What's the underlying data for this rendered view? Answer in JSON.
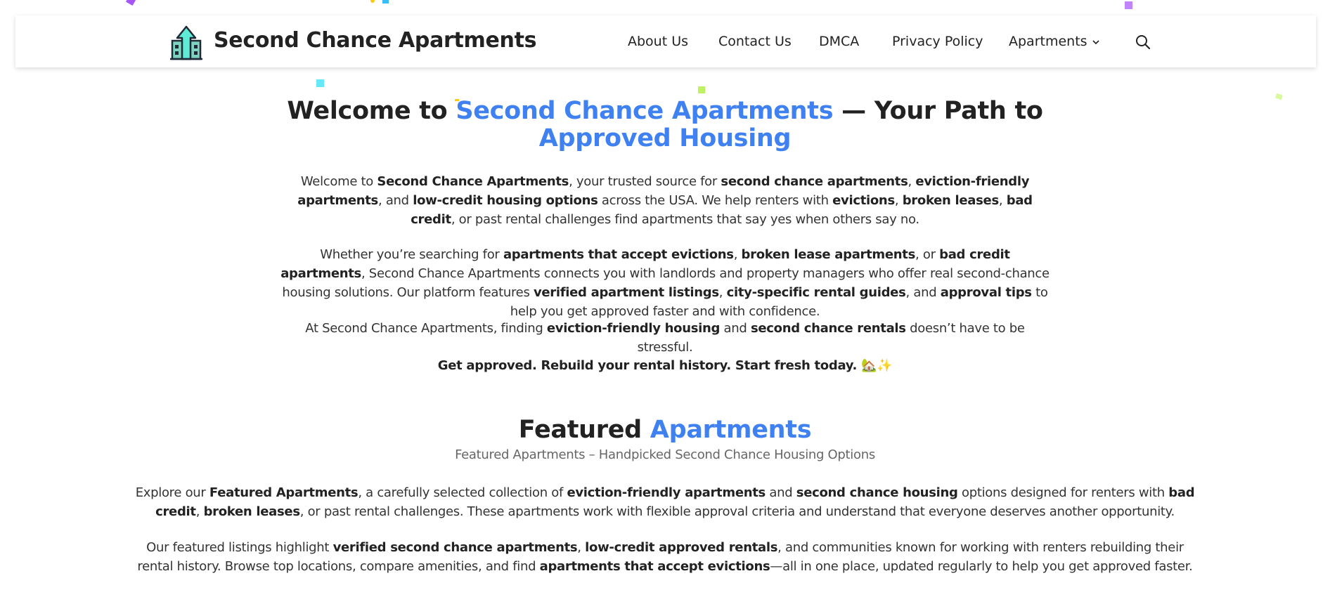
{
  "header": {
    "site_title": "Second Chance Apartments",
    "logo_icon": "apartment-arrow-up-icon",
    "nav": [
      {
        "label": "About Us"
      },
      {
        "label": "Contact Us"
      },
      {
        "label": "DMCA"
      },
      {
        "label": "Privacy Policy"
      },
      {
        "label": "Apartments",
        "icon": "chevron-down-icon"
      }
    ],
    "search_icon": "search-icon"
  },
  "colors": {
    "accent": "#3f81f0",
    "text": "#222222",
    "subtitle": "#666666",
    "confetti": [
      "#a855f7",
      "#facc15",
      "#38bdf8",
      "#c084fc",
      "#67e8f9",
      "#bef264",
      "#d9f99d"
    ]
  },
  "hero": {
    "title_1": "Welcome to ",
    "title_2": "Second Chance Apartments",
    "title_3": " — Your Path to ",
    "title_4": "Approved Housing",
    "p1": {
      "t1": "Welcome to ",
      "b1": "Second Chance Apartments",
      "t2": ", your trusted source for ",
      "b2": "second chance apartments",
      "t3": ", ",
      "b3": "eviction-friendly apartments",
      "t4": ", and ",
      "b4": "low-credit housing options",
      "t5": " across the USA. We help renters with ",
      "b5": "evictions",
      "t6": ", ",
      "b6": "broken leases",
      "t7": ", ",
      "b7": "bad credit",
      "t8": ", or past rental challenges find apartments that say yes when others say no."
    },
    "p2": {
      "t1": "Whether you’re searching for ",
      "b1": "apartments that accept evictions",
      "t2": ", ",
      "b2": "broken lease apartments",
      "t3": ", or ",
      "b3": "bad credit apartments",
      "t4": ", Second Chance Apartments connects you with landlords and property managers who offer real second-chance housing solutions. Our platform features ",
      "b4": "verified apartment listings",
      "t5": ", ",
      "b5": "city-specific rental guides",
      "t6": ", and ",
      "b6": "approval tips",
      "t7": " to help you get approved faster and with confidence."
    },
    "p3": {
      "t1": "At Second Chance Apartments, finding ",
      "b1": "eviction-friendly housing",
      "t2": " and ",
      "b2": "second chance rentals",
      "t3": " doesn’t have to be stressful."
    },
    "p4": {
      "b1": "Get approved. Rebuild your rental history. Start fresh today. ",
      "emoji": "🏡✨"
    }
  },
  "featured": {
    "title_1": "Featured ",
    "title_2": "Apartments",
    "subtitle": "Featured Apartments – Handpicked Second Chance Housing Options",
    "p1": {
      "t1": "Explore our ",
      "b1": "Featured Apartments",
      "t2": ", a carefully selected collection of ",
      "b2": "eviction-friendly apartments",
      "t3": " and ",
      "b3": "second chance housing",
      "t4": " options designed for renters with ",
      "b4": "bad credit",
      "t5": ", ",
      "b5": "broken leases",
      "t6": ", or past rental challenges. These apartments work with flexible approval criteria and understand that everyone deserves another opportunity."
    },
    "p2": {
      "t1": "Our featured listings highlight ",
      "b1": "verified second chance apartments",
      "t2": ", ",
      "b2": "low-credit approved rentals",
      "t3": ", and communities known for working with renters rebuilding their rental history. Browse top locations, compare amenities, and find ",
      "b3": "apartments that accept evictions",
      "t4": "—all in one place, updated regularly to help you get approved faster."
    }
  }
}
